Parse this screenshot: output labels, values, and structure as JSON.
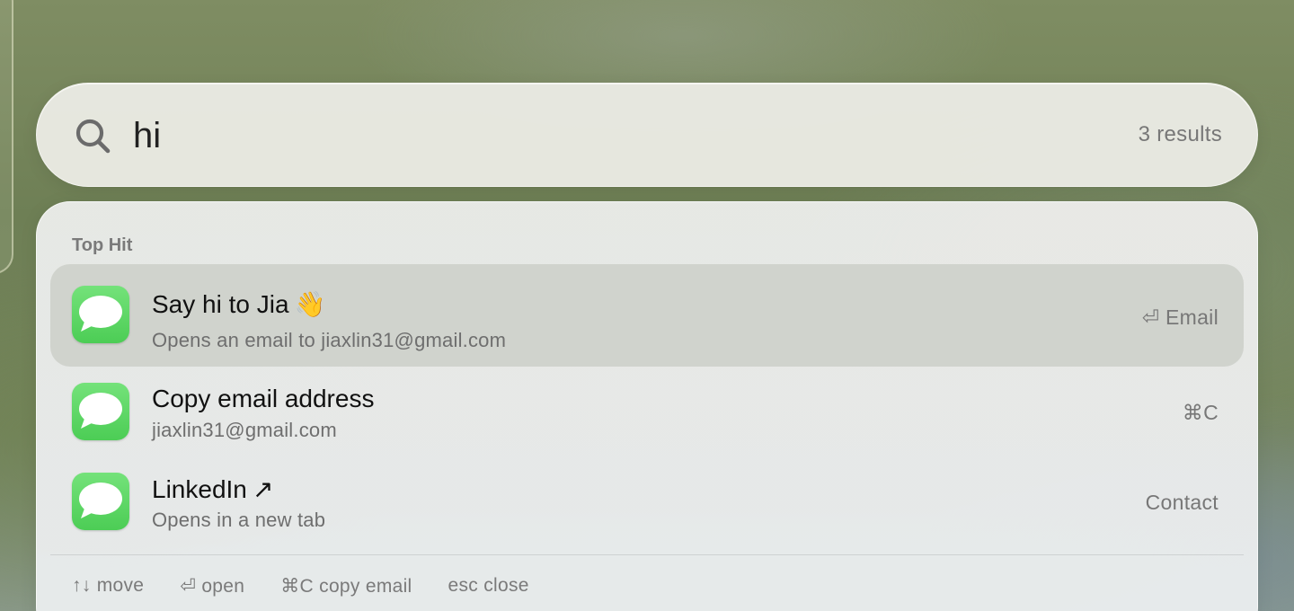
{
  "search": {
    "value": "hi",
    "result_count": "3 results"
  },
  "section_label": "Top Hit",
  "results": [
    {
      "title": "Say hi to Jia",
      "emoji": "👋",
      "subtitle": "Opens an email to jiaxlin31@gmail.com",
      "action": "⏎ Email",
      "icon": "messages-icon",
      "selected": true
    },
    {
      "title": "Copy email address",
      "emoji": "",
      "subtitle": "jiaxlin31@gmail.com",
      "action": "⌘C",
      "icon": "messages-icon",
      "selected": false
    },
    {
      "title": "LinkedIn",
      "emoji": "↗",
      "subtitle": "Opens in a new tab",
      "action": "Contact",
      "icon": "messages-icon",
      "selected": false
    }
  ],
  "footer": {
    "move": "↑↓ move",
    "open": "⏎ open",
    "copy": "⌘C copy email",
    "close": "esc close"
  },
  "colors": {
    "icon_green": "#4ccd55",
    "selected_row": "#c8cac4"
  }
}
